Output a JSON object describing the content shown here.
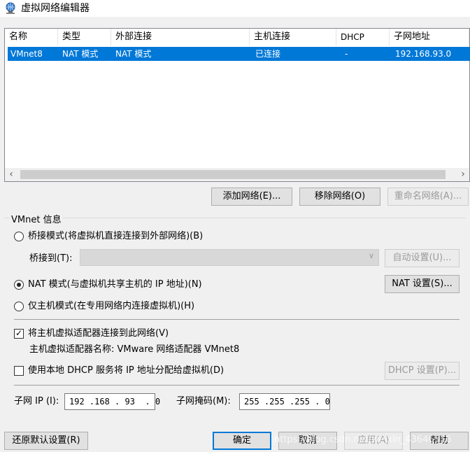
{
  "window": {
    "title": "虚拟网络编辑器",
    "icon": "globe-network-icon"
  },
  "table": {
    "columns": [
      "名称",
      "类型",
      "外部连接",
      "主机连接",
      "DHCP",
      "子网地址"
    ],
    "rows": [
      {
        "name": "VMnet8",
        "type": "NAT 模式",
        "external": "NAT 模式",
        "host": "已连接",
        "dhcp": "-",
        "subnet": "192.168.93.0",
        "selected": true
      }
    ]
  },
  "scrollbar": {
    "left_icon": "chevron-left-icon",
    "right_icon": "chevron-right-icon"
  },
  "list_buttons": {
    "add": "添加网络(E)...",
    "remove": "移除网络(O)",
    "rename": "重命名网络(A)..."
  },
  "vmnet_info": {
    "group_label": "VMnet 信息",
    "bridged": {
      "label": "桥接模式(将虚拟机直接连接到外部网络)(B)",
      "checked": false
    },
    "bridge_to_label": "桥接到(T):",
    "auto_settings": "自动设置(U)...",
    "nat": {
      "label": "NAT 模式(与虚拟机共享主机的 IP 地址)(N)",
      "checked": true
    },
    "nat_settings": "NAT 设置(S)...",
    "hostonly": {
      "label": "仅主机模式(在专用网络内连接虚拟机)(H)",
      "checked": false
    },
    "connect_adapter": {
      "label": "将主机虚拟适配器连接到此网络(V)",
      "checked": true
    },
    "adapter_name": "主机虚拟适配器名称: VMware 网络适配器 VMnet8",
    "use_dhcp": {
      "label": "使用本地 DHCP 服务将 IP 地址分配给虚拟机(D)",
      "checked": false
    },
    "dhcp_settings": "DHCP 设置(P)...",
    "subnet_ip_label": "子网 IP (I):",
    "subnet_ip": "192 .168 . 93  . 0",
    "subnet_mask_label": "子网掩码(M):",
    "subnet_mask": "255 .255 .255 . 0"
  },
  "footer": {
    "restore": "还原默认设置(R)",
    "ok": "确定",
    "cancel": "取消",
    "apply": "应用(A)",
    "help": "帮助"
  },
  "watermark": "https://blog.csdn.net/weixin_43646516"
}
